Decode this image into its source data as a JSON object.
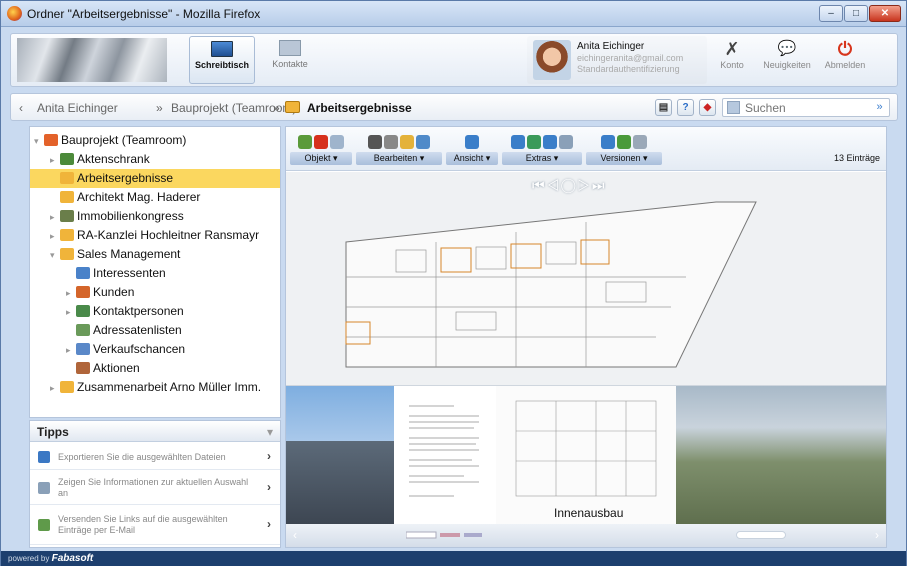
{
  "window": {
    "title": "Ordner \"Arbeitsergebnisse\" - Mozilla Firefox",
    "min": "–",
    "max": "□",
    "close": "✕"
  },
  "nav": {
    "desk": "Schreibtisch",
    "contacts": "Kontakte"
  },
  "user": {
    "name": "Anita Eichinger",
    "email": "eichingeranita@gmail.com",
    "auth": "Standardauthentifizierung"
  },
  "topbar": {
    "konto": "Konto",
    "konto_icon": "✗",
    "news": "Neuigkeiten",
    "news_icon": "💬",
    "logout": "Abmelden",
    "logout_icon": "⏻"
  },
  "breadcrumb": {
    "back": "‹",
    "items": [
      "Anita Eichinger",
      "Bauprojekt (Teamroom)",
      "Arbeitsergebnisse"
    ],
    "sep": "»"
  },
  "search": {
    "placeholder": "Suchen",
    "go": "»"
  },
  "tree": [
    {
      "label": "Bauprojekt (Teamroom)",
      "exp": "▾",
      "level": 0,
      "icon": "teamroom-icon",
      "color": "#e3622a"
    },
    {
      "label": "Aktenschrank",
      "exp": "▸",
      "level": 1,
      "icon": "cabinet-icon",
      "color": "#4c8a3a"
    },
    {
      "label": "Arbeitsergebnisse",
      "exp": "",
      "level": 1,
      "icon": "folder-icon",
      "color": "#f0b43a",
      "selected": true
    },
    {
      "label": "Architekt Mag. Haderer",
      "exp": "",
      "level": 1,
      "icon": "folder-icon",
      "color": "#f0b43a"
    },
    {
      "label": "Immobilienkongress",
      "exp": "▸",
      "level": 1,
      "icon": "event-icon",
      "color": "#6a7e4a"
    },
    {
      "label": "RA-Kanzlei Hochleitner Ransmayr",
      "exp": "▸",
      "level": 1,
      "icon": "folder-icon",
      "color": "#f0b43a"
    },
    {
      "label": "Sales Management",
      "exp": "▾",
      "level": 1,
      "icon": "folder-icon",
      "color": "#f0b43a"
    },
    {
      "label": "Interessenten",
      "exp": "",
      "level": 2,
      "icon": "contacts-icon",
      "color": "#4a82c9"
    },
    {
      "label": "Kunden",
      "exp": "▸",
      "level": 2,
      "icon": "customers-icon",
      "color": "#d4652a"
    },
    {
      "label": "Kontaktpersonen",
      "exp": "▸",
      "level": 2,
      "icon": "people-icon",
      "color": "#4a8a4a"
    },
    {
      "label": "Adressatenlisten",
      "exp": "",
      "level": 2,
      "icon": "list-icon",
      "color": "#6a9a5a"
    },
    {
      "label": "Verkaufschancen",
      "exp": "▸",
      "level": 2,
      "icon": "chart-icon",
      "color": "#5a88c8"
    },
    {
      "label": "Aktionen",
      "exp": "",
      "level": 2,
      "icon": "action-icon",
      "color": "#b0653a"
    },
    {
      "label": "Zusammenarbeit Arno Müller Imm.",
      "exp": "▸",
      "level": 1,
      "icon": "folder-icon",
      "color": "#f0b43a"
    }
  ],
  "tips": {
    "title": "Tipps",
    "collapse": "▾",
    "items": [
      {
        "text": "Exportieren Sie die ausgewählten Dateien",
        "icon": "export-icon",
        "color": "#3b78c4"
      },
      {
        "text": "Zeigen Sie Informationen zur aktuellen Auswahl an",
        "icon": "info-icon",
        "color": "#8aa0b8"
      },
      {
        "text": "Versenden Sie Links auf die ausgewählten Einträge per E-Mail",
        "icon": "mail-link-icon",
        "color": "#5f9a4a"
      }
    ],
    "arrow": "›"
  },
  "toolbar": {
    "groups": [
      {
        "label": "Objekt ▾",
        "icons": [
          "#5a9a3a",
          "#d6301c",
          "#9fb4cc"
        ]
      },
      {
        "label": "Bearbeiten ▾",
        "icons": [
          "#555",
          "#888",
          "#e4b23a",
          "#4f8ac9"
        ]
      },
      {
        "label": "Ansicht ▾",
        "icons": [
          "#3a7ec9"
        ]
      },
      {
        "label": "Extras ▾",
        "icons": [
          "#3a7ec9",
          "#3a9a5a",
          "#3a7ec9",
          "#8aa0b8"
        ]
      },
      {
        "label": "Versionen ▾",
        "icons": [
          "#3a7ec9",
          "#4a9a3a",
          "#9aa8b8"
        ]
      }
    ],
    "count": "13 Einträge"
  },
  "player": {
    "controls": "⏮◁◯▷⏭"
  },
  "thumbs": {
    "caption": "Innenausbau"
  },
  "scroll": {
    "left": "‹",
    "right": "›"
  },
  "footer": {
    "powered": "powered by",
    "brand": "Fabasoft"
  }
}
